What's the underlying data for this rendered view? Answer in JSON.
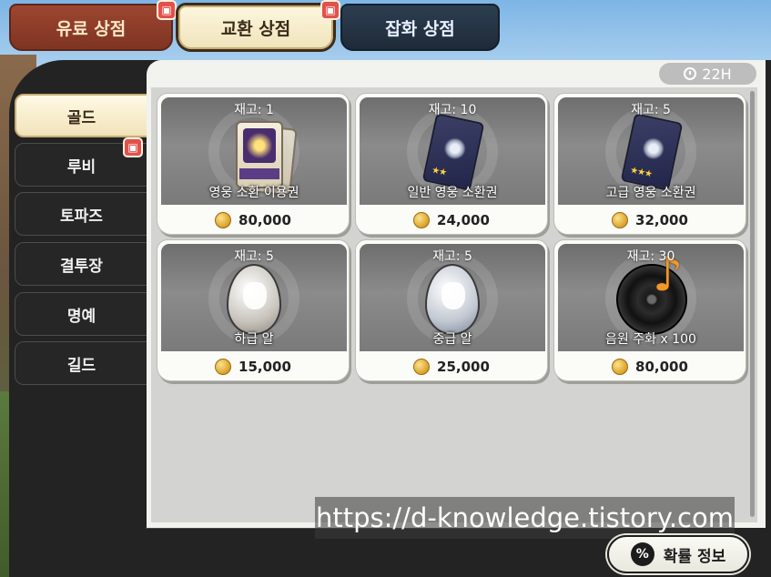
{
  "top_tabs": [
    {
      "label": "유료 상점",
      "active": false
    },
    {
      "label": "교환 상점",
      "active": true
    },
    {
      "label": "잡화 상점",
      "active": false
    }
  ],
  "side_nav": [
    {
      "label": "골드",
      "active": true
    },
    {
      "label": "루비",
      "active": false
    },
    {
      "label": "토파즈",
      "active": false
    },
    {
      "label": "결투장",
      "active": false
    },
    {
      "label": "명예",
      "active": false
    },
    {
      "label": "길드",
      "active": false
    }
  ],
  "timer": {
    "label": "22H",
    "icon": "stopwatch-icon"
  },
  "items": [
    {
      "stock": "재고: 1",
      "name": "영웅 소환 이용권",
      "price": "80,000"
    },
    {
      "stock": "재고: 10",
      "name": "일반 영웅 소환권",
      "price": "24,000"
    },
    {
      "stock": "재고: 5",
      "name": "고급 영웅 소환권",
      "price": "32,000"
    },
    {
      "stock": "재고: 5",
      "name": "하급 알",
      "price": "15,000"
    },
    {
      "stock": "재고: 5",
      "name": "중급 알",
      "price": "25,000"
    },
    {
      "stock": "재고: 30",
      "name": "음원 주화 x 100",
      "price": "80,000"
    }
  ],
  "prob_button": {
    "label": "확률 정보",
    "icon_text": "%"
  },
  "watermark": "https://d-knowledge.tistory.com",
  "colors": {
    "paid_tab": "#9c4630",
    "exchange_tab": "#f4ead0",
    "misc_tab": "#2d3e52",
    "frame": "#232323",
    "gift_badge": "#e2514a",
    "coin": "#d9a12a"
  }
}
